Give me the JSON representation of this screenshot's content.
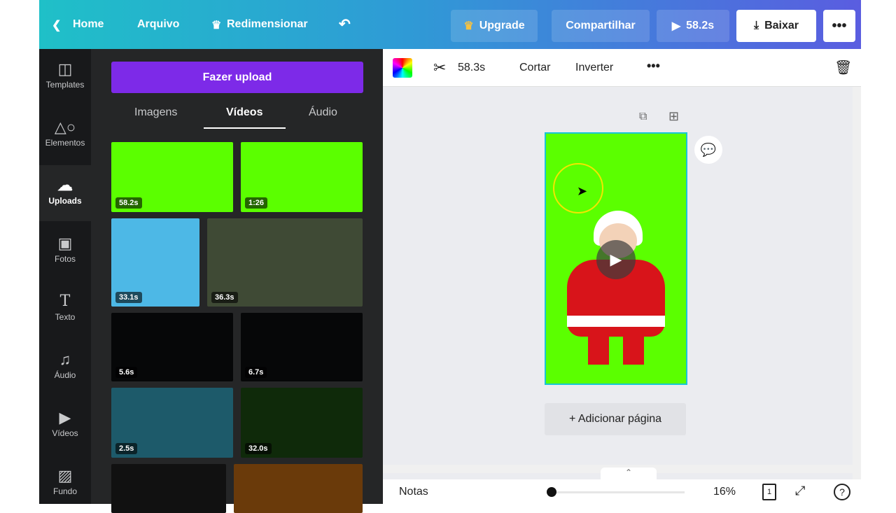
{
  "topbar": {
    "home": "Home",
    "arquivo": "Arquivo",
    "redimensionar": "Redimensionar",
    "upgrade": "Upgrade",
    "compartilhar": "Compartilhar",
    "play_duration": "58.2s",
    "baixar": "Baixar"
  },
  "rail": [
    {
      "label": "Templates",
      "icon": "template-icon"
    },
    {
      "label": "Elementos",
      "icon": "shapes-icon"
    },
    {
      "label": "Uploads",
      "icon": "cloud-upload-icon"
    },
    {
      "label": "Fotos",
      "icon": "image-icon"
    },
    {
      "label": "Texto",
      "icon": "text-icon"
    },
    {
      "label": "Áudio",
      "icon": "music-icon"
    },
    {
      "label": "Vídeos",
      "icon": "video-icon"
    },
    {
      "label": "Fundo",
      "icon": "pattern-icon"
    }
  ],
  "panel": {
    "upload_button": "Fazer upload",
    "tabs": [
      "Imagens",
      "Vídeos",
      "Áudio"
    ],
    "videos": [
      {
        "duration": "58.2s",
        "color": "#5bff00"
      },
      {
        "duration": "1:26",
        "color": "#5bff00"
      },
      {
        "duration": "33.1s",
        "color": "#4db8e6"
      },
      {
        "duration": "36.3s",
        "color": "#3f4a35"
      },
      {
        "duration": "5.6s",
        "color": "#060708"
      },
      {
        "duration": "6.7s",
        "color": "#060708"
      },
      {
        "duration": "2.5s",
        "color": "#1d5a6a"
      },
      {
        "duration": "32.0s",
        "color": "#0f2a0a"
      },
      {
        "duration": "",
        "color": "#111"
      },
      {
        "duration": "",
        "color": "#6a3a0a"
      }
    ]
  },
  "toolbar": {
    "duration": "58.3s",
    "cortar": "Cortar",
    "inverter": "Inverter"
  },
  "canvas": {
    "add_page": "+ Adicionar página",
    "page_color": "#5bff00"
  },
  "bottom": {
    "notas": "Notas",
    "zoom": "16%",
    "page_number": "1",
    "zoom_fraction": 0.0
  }
}
